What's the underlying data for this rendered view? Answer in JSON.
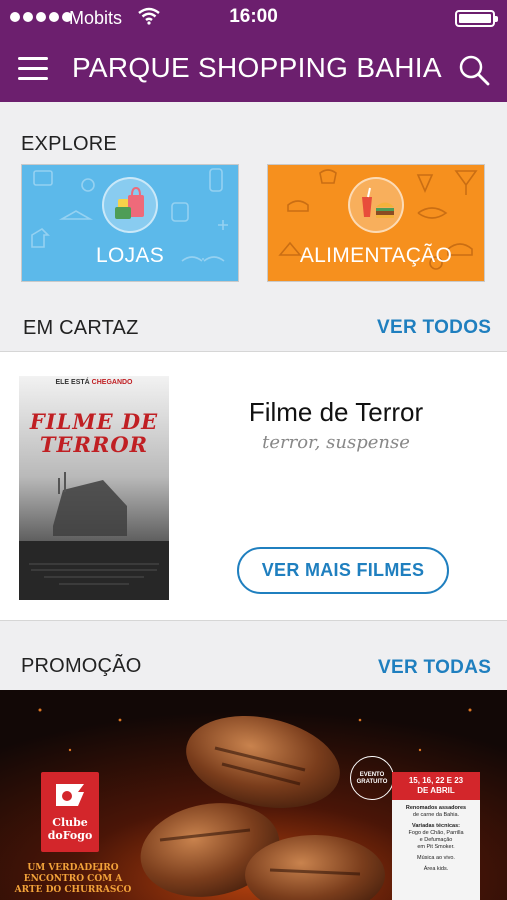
{
  "status_bar": {
    "carrier": "Mobits",
    "time": "16:00",
    "icons": [
      "signal-dots-icon",
      "wifi-icon",
      "battery-icon"
    ]
  },
  "header": {
    "title": "PARQUE SHOPPING BAHIA",
    "icons": [
      "menu-icon",
      "search-icon"
    ],
    "color": "#6c1f6e"
  },
  "explore": {
    "title": "EXPLORE",
    "tiles": [
      {
        "label": "LOJAS",
        "icon": "shopping-bags-icon",
        "color": "#5cb9ea"
      },
      {
        "label": "ALIMENTAÇÃO",
        "icon": "soda-burger-icon",
        "color": "#f6901e"
      }
    ]
  },
  "em_cartaz": {
    "title": "EM CARTAZ",
    "link": "VER TODOS",
    "movie": {
      "title": "Filme de Terror",
      "genres": "terror, suspense",
      "poster": {
        "tagline_prefix": "ELE ESTÁ",
        "tagline_highlight": "CHEGANDO",
        "title_line1": "FILME DE",
        "title_line2": "TERROR"
      }
    },
    "more_button": "VER MAIS FILMES"
  },
  "promocao": {
    "title": "PROMOÇÃO",
    "link": "VER TODAS",
    "banner": {
      "brand_line1": "Clube",
      "brand_line2": "doFogo",
      "slogan_line1": "UM VERDADEIRO",
      "slogan_line2": "ENCONTRO COM A",
      "slogan_line3": "ARTE DO CHURRASCO",
      "badge_line1": "EVENTO",
      "badge_line2": "GRATUITO",
      "dates_line1": "15, 16, 22 E 23",
      "dates_line2": "DE ABRIL",
      "info1_line1": "Renomados assadores",
      "info1_line2": "de carne da Bahia.",
      "info2_title": "Variadas técnicas:",
      "info2_line1": "Fogo de Chão, Parrilla",
      "info2_line2": "e Defumação",
      "info2_line3": "em Pit Smoker.",
      "info3": "Música ao vivo.",
      "info4": "Área kids."
    }
  },
  "accent_color": "#1f7fbf"
}
